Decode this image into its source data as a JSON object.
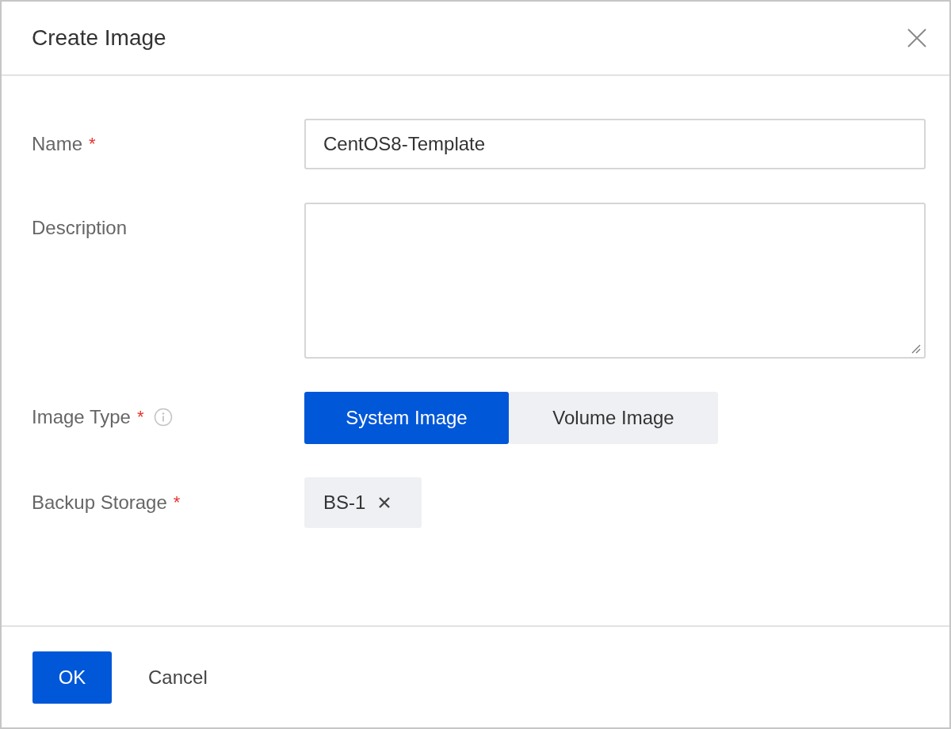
{
  "dialog": {
    "title": "Create Image"
  },
  "fields": [
    {
      "kind": "text",
      "label": "Name",
      "required_mark": "*",
      "value": "CentOS8-Template"
    },
    {
      "kind": "textarea",
      "label": "Description"
    },
    {
      "kind": "segmented",
      "label": "Image Type",
      "required_mark": "*",
      "options": [
        {
          "label": "System Image",
          "selected": true
        },
        {
          "label": "Volume Image",
          "selected": false
        }
      ]
    },
    {
      "kind": "tags",
      "label": "Backup Storage",
      "required_mark": "*",
      "tags": [
        "BS-1"
      ]
    }
  ],
  "buttons": [
    {
      "label": "OK",
      "kind": "primary"
    },
    {
      "label": "Cancel",
      "kind": "link"
    }
  ]
}
